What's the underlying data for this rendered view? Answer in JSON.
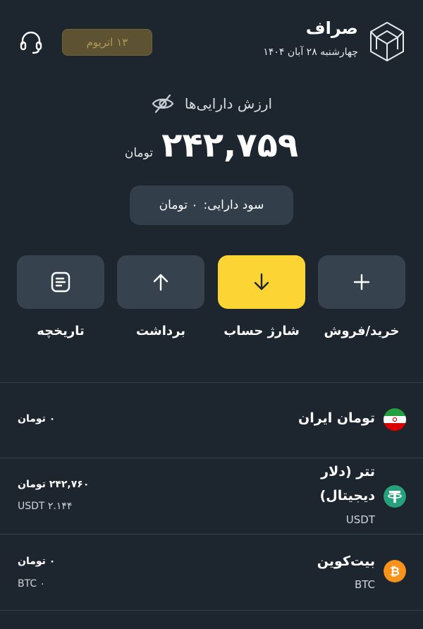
{
  "header": {
    "title": "صراف",
    "date": "چهارشنبه ۲۸ آبان ۱۴۰۴",
    "badge": "۱۳ اتریوم",
    "logo_icon": "cube-logo-icon",
    "support_icon": "headset-icon"
  },
  "balance": {
    "label": "ارزش دارایی‌ها",
    "value": "۲۴۲,۷۵۹",
    "unit": "تومان",
    "visibility_icon": "eye-off-icon",
    "profit_label": "سود دارایی:",
    "profit_value": "۰ تومان"
  },
  "actions": [
    {
      "label": "خرید/فروش",
      "icon": "plus-icon"
    },
    {
      "label": "شارژ حساب",
      "icon": "arrow-down-icon"
    },
    {
      "label": "برداشت",
      "icon": "arrow-up-icon"
    },
    {
      "label": "تاریخچه",
      "icon": "document-icon"
    }
  ],
  "assets": [
    {
      "name": "تومان ایران",
      "amount": "۰ تومان",
      "icon": "iran-flag-icon"
    },
    {
      "name_line1": "تتر (دلار",
      "name_line2": "دیجیتال)",
      "symbol": "USDT",
      "amount": "۲۴۲,۷۶۰ تومان",
      "qty": "USDT ۲.۱۴۴",
      "icon": "tether-icon"
    },
    {
      "name": "بیت‌کوین",
      "symbol": "BTC",
      "amount": "۰ تومان",
      "qty": "BTC ۰",
      "icon": "bitcoin-icon"
    }
  ],
  "colors": {
    "background": "#1d252e",
    "card": "#36434f",
    "accent": "#fcd535",
    "tether": "#26a17b",
    "bitcoin": "#f7931a"
  }
}
